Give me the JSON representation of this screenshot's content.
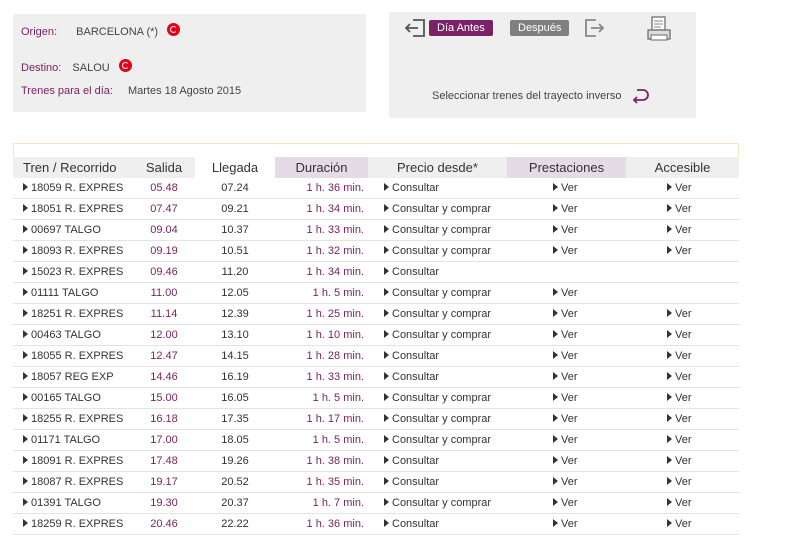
{
  "search": {
    "origin_label": "Origen:",
    "origin_value": "BARCELONA (*)",
    "destination_label": "Destino:",
    "destination_value": "SALOU",
    "date_label": "Trenes para el día:",
    "date_value": "Martes  18  Agosto  2015"
  },
  "nav": {
    "prev_label": "Día Antes",
    "next_label": "Después",
    "inverse_label": "Seleccionar trenes del trayecto inverso"
  },
  "table": {
    "headers": [
      "Tren / Recorrido",
      "Salida",
      "Llegada",
      "Duración",
      "Precio desde*",
      "Prestaciones",
      "Accesible"
    ],
    "rows": [
      {
        "tren": "18059 R. EXPRES",
        "salida": "05.48",
        "llegada": "07.24",
        "duracion": "1 h. 36 min.",
        "precio": "Consultar",
        "prestaciones": "Ver",
        "accesible": "Ver"
      },
      {
        "tren": "18051 R. EXPRES",
        "salida": "07.47",
        "llegada": "09.21",
        "duracion": "1 h. 34 min.",
        "precio": "Consultar y comprar",
        "prestaciones": "Ver",
        "accesible": "Ver"
      },
      {
        "tren": "00697 TALGO",
        "salida": "09.04",
        "llegada": "10.37",
        "duracion": "1 h. 33 min.",
        "precio": "Consultar y comprar",
        "prestaciones": "Ver",
        "accesible": "Ver"
      },
      {
        "tren": "18093 R. EXPRES",
        "salida": "09.19",
        "llegada": "10.51",
        "duracion": "1 h. 32 min.",
        "precio": "Consultar y comprar",
        "prestaciones": "Ver",
        "accesible": "Ver"
      },
      {
        "tren": "15023 R. EXPRES",
        "salida": "09.46",
        "llegada": "11.20",
        "duracion": "1 h. 34 min.",
        "precio": "Consultar",
        "prestaciones": "",
        "accesible": ""
      },
      {
        "tren": "01111 TALGO",
        "salida": "11.00",
        "llegada": "12.05",
        "duracion": "1 h. 5 min.",
        "precio": "Consultar y comprar",
        "prestaciones": "Ver",
        "accesible": ""
      },
      {
        "tren": "18251 R. EXPRES",
        "salida": "11.14",
        "llegada": "12.39",
        "duracion": "1 h. 25 min.",
        "precio": "Consultar y comprar",
        "prestaciones": "Ver",
        "accesible": "Ver"
      },
      {
        "tren": "00463 TALGO",
        "salida": "12.00",
        "llegada": "13.10",
        "duracion": "1 h. 10 min.",
        "precio": "Consultar y comprar",
        "prestaciones": "Ver",
        "accesible": "Ver"
      },
      {
        "tren": "18055 R. EXPRES",
        "salida": "12.47",
        "llegada": "14.15",
        "duracion": "1 h. 28 min.",
        "precio": "Consultar",
        "prestaciones": "Ver",
        "accesible": "Ver"
      },
      {
        "tren": "18057 REG EXP",
        "salida": "14.46",
        "llegada": "16.19",
        "duracion": "1 h. 33 min.",
        "precio": "Consultar",
        "prestaciones": "Ver",
        "accesible": "Ver"
      },
      {
        "tren": "00165 TALGO",
        "salida": "15.00",
        "llegada": "16.05",
        "duracion": "1 h. 5 min.",
        "precio": "Consultar y comprar",
        "prestaciones": "Ver",
        "accesible": "Ver"
      },
      {
        "tren": "18255 R. EXPRES",
        "salida": "16.18",
        "llegada": "17.35",
        "duracion": "1 h. 17 min.",
        "precio": "Consultar y comprar",
        "prestaciones": "Ver",
        "accesible": "Ver"
      },
      {
        "tren": "01171 TALGO",
        "salida": "17.00",
        "llegada": "18.05",
        "duracion": "1 h. 5 min.",
        "precio": "Consultar y comprar",
        "prestaciones": "Ver",
        "accesible": "Ver"
      },
      {
        "tren": "18091 R. EXPRES",
        "salida": "17.48",
        "llegada": "19.26",
        "duracion": "1 h. 38 min.",
        "precio": "Consultar",
        "prestaciones": "Ver",
        "accesible": "Ver"
      },
      {
        "tren": "18087 R. EXPRES",
        "salida": "19.17",
        "llegada": "20.52",
        "duracion": "1 h. 35 min.",
        "precio": "Consultar",
        "prestaciones": "Ver",
        "accesible": "Ver"
      },
      {
        "tren": "01391 TALGO",
        "salida": "19.30",
        "llegada": "20.37",
        "duracion": "1 h. 7 min.",
        "precio": "Consultar y comprar",
        "prestaciones": "Ver",
        "accesible": "Ver"
      },
      {
        "tren": "18259 R. EXPRES",
        "salida": "20.46",
        "llegada": "22.22",
        "duracion": "1 h. 36 min.",
        "precio": "Consultar",
        "prestaciones": "Ver",
        "accesible": "Ver"
      }
    ]
  },
  "colors": {
    "accent": "#7a2265",
    "marker": "#e2001a",
    "panel": "#efefef",
    "highlight": "#e4dbe6"
  },
  "icons": [
    "location-icon",
    "arrow-left-icon",
    "arrow-right-icon",
    "print-icon",
    "return-icon",
    "triangle-icon"
  ]
}
